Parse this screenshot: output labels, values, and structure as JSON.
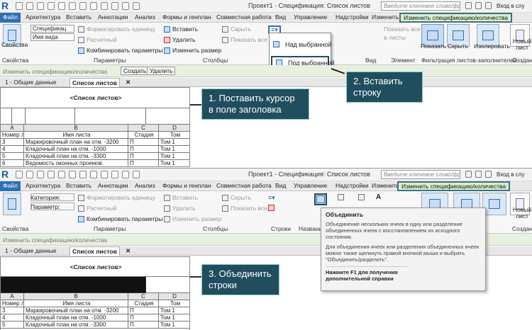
{
  "top": {
    "app_logo": "R",
    "title": "Проект1 - Спецификация: Список листов",
    "search_placeholder": "Введите ключевое слово/фразу",
    "login": "Вход в слу",
    "tabs": [
      "Файл",
      "Архитектура",
      "Вставить",
      "Аннотации",
      "Анализ",
      "Формы и генплан",
      "Совместная работа",
      "Вид",
      "Управление",
      "Надстройки",
      "Изменить",
      "Изменить спецификацию/количества"
    ],
    "ribbon": {
      "properties_label": "Свойства",
      "combo1": "Спецификац",
      "combo2": "Имя вида",
      "format_unit": "Форматировать единицу",
      "calculated": "Расчетный",
      "combine_params": "Комбинировать параметры",
      "params_label": "Параметры",
      "insert": "Вставить",
      "delete": "Удалить",
      "resize": "Изменить размер",
      "hide": "Скрыть",
      "show_all": "Показать все",
      "columns_label": "Столбцы",
      "show_all_sheets": "Показать все",
      "in_sheets": "в листы",
      "show": "Показать",
      "hide2": "Скрыть",
      "isolate": "Изолировать",
      "new_sheet": "Новый лист",
      "view_label": "Вид",
      "element_label": "Элемент",
      "filter_label": "Фильтрация листов-заполнителей",
      "create_label": "Создани"
    },
    "dropdown": [
      "Над выбранной",
      "Под выбранной"
    ],
    "propbar": {
      "placeholder": "Изменить спецификацию/количества",
      "create": "Создать",
      "delete": "Удалить"
    },
    "doctabs": [
      "1 - Общие данные",
      "Список листов"
    ],
    "sheet": {
      "title": "<Список листов>",
      "col_letters": [
        "A",
        "B",
        "C",
        "D"
      ],
      "headers": [
        "Номер лис",
        "Имя листа",
        "Стадия",
        "Том"
      ],
      "rows": [
        [
          "3",
          "Маркировочный план на отм. -3200",
          "П",
          "Том 1"
        ],
        [
          "4",
          "Кладочный план на отм. -1000",
          "П",
          "Том 1"
        ],
        [
          "5",
          "Кладочный план на отм. -3300",
          "П",
          "Том 1"
        ],
        [
          "6",
          "Ведомость оконных проемов",
          "П",
          "Том 1"
        ]
      ]
    },
    "callout1": [
      "1. Поставить курсор",
      "в поле заголовка"
    ],
    "callout2": [
      "2. Вставить",
      "строку"
    ]
  },
  "bottom": {
    "title": "Проект1 - Спецификация: Список листов",
    "search_placeholder": "Введите ключевое слово/фразу",
    "login": "Вход в слу",
    "tabs": [
      "Файл",
      "Архитектура",
      "Вставить",
      "Аннотации",
      "Анализ",
      "Формы и генплан",
      "Совместная работа",
      "Вид",
      "Управление",
      "Надстройки",
      "Изменить",
      "Изменить спецификацию/количества"
    ],
    "ribbon": {
      "category": "Категория:",
      "parameter": "Параметр:",
      "format_unit": "Форматировать единицу",
      "calculated": "Расчетный",
      "combine_params": "Комбинировать параметры",
      "insert": "Вставить",
      "delete": "Удалить",
      "resize": "Изменить размер",
      "hide": "Скрыть",
      "show_all": "Показать все",
      "new_sheet": "Новый лист",
      "labels": [
        "Свойства",
        "Параметры",
        "Столбцы",
        "Строки",
        "Названия",
        "Создани"
      ]
    },
    "propbar": {
      "placeholder": "Изменить спецификацию/количества"
    },
    "doctabs": [
      "1 - Общие данные",
      "Список листов"
    ],
    "sheet": {
      "title": "<Список листов>",
      "col_letters": [
        "A",
        "B",
        "C",
        "D"
      ],
      "headers": [
        "Номер листа",
        "Имя листа",
        "Стадия",
        "Том"
      ],
      "rows": [
        [
          "3",
          "Маркировочный план на отм. -3200",
          "П",
          "Том 1"
        ],
        [
          "4",
          "Кладочный план на отм. -1000",
          "П",
          "Том 1"
        ],
        [
          "5",
          "Кладочный план на отм. -3300",
          "П",
          "Том 1"
        ]
      ]
    },
    "tooltip": {
      "title": "Объединить",
      "p1": "Объединение нескольких ячеек в одну или разделение объединенных ячеек с восстановлением их исходного состояния.",
      "p2": "Для объединения ячеек или разделения объединенных ячеек можно также щелкнуть правой кнопкой мыши и выбрать \"Объединить/разделить\".",
      "help": "Нажмите F1 для получения дополнительной справки"
    },
    "callout3": [
      "3. Объединить",
      "строки"
    ]
  }
}
